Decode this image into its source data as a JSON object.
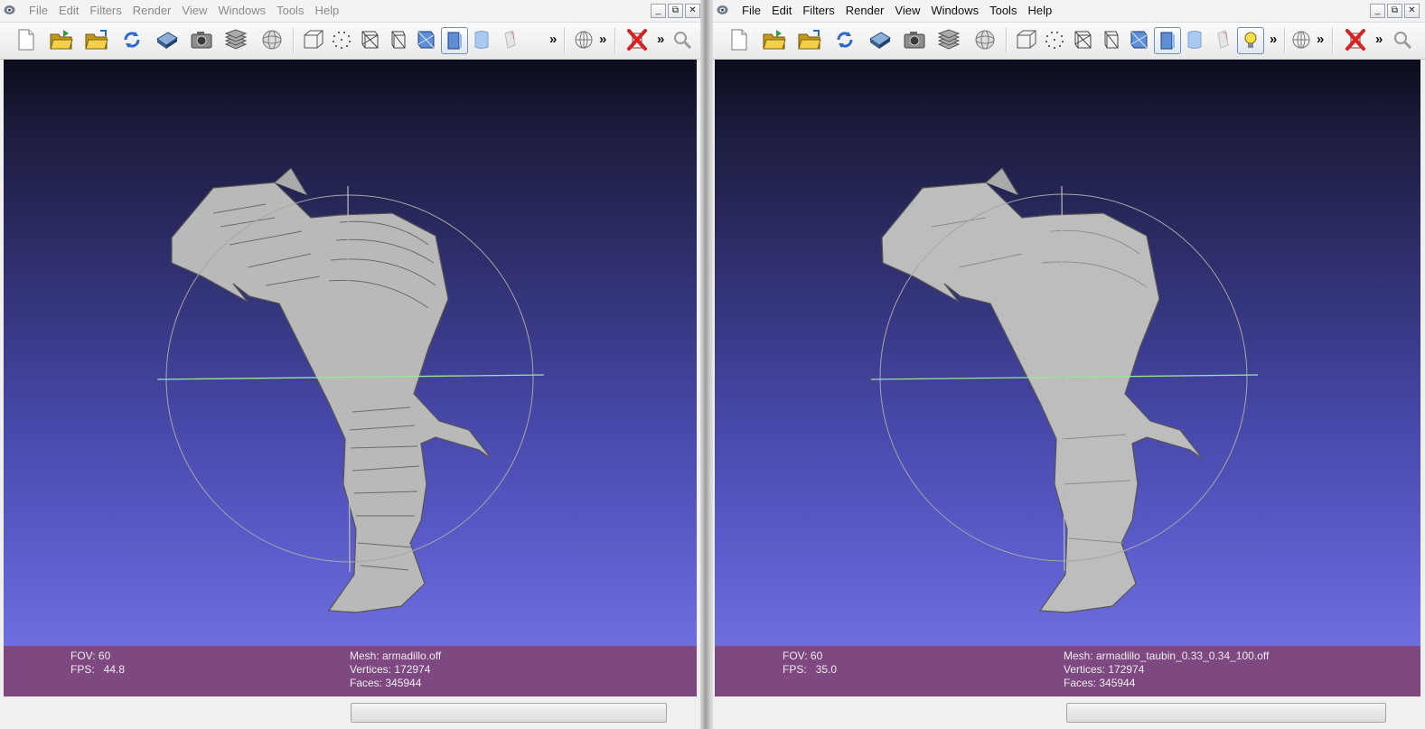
{
  "left": {
    "menus": [
      "File",
      "Edit",
      "Filters",
      "Render",
      "View",
      "Windows",
      "Tools",
      "Help"
    ],
    "window_controls": [
      "_",
      "⧉",
      "✕"
    ],
    "toolbar_overflow": "»",
    "info": {
      "fov": "FOV: 60",
      "fps": "FPS:   44.8",
      "mesh": "Mesh: armadillo.off",
      "vertices": "Vertices: 172974",
      "faces": "Faces: 345944"
    }
  },
  "right": {
    "menus": [
      "File",
      "Edit",
      "Filters",
      "Render",
      "View",
      "Windows",
      "Tools",
      "Help"
    ],
    "window_controls": [
      "_",
      "⧉",
      "✕"
    ],
    "toolbar_overflow": "»",
    "info": {
      "fov": "FOV: 60",
      "fps": "FPS:   35.0",
      "mesh": "Mesh: armadillo_taubin_0.33_0.34_100.off",
      "vertices": "Vertices: 172974",
      "faces": "Faces: 345944"
    }
  },
  "colors": {
    "info_bar": "#7d4980",
    "trackball_axis": "#9be59b",
    "mesh": "#b9b9b9"
  },
  "icons": [
    "new-file-icon",
    "open-folder-icon",
    "import-folder-icon",
    "reload-icon",
    "save-icon",
    "snapshot-icon",
    "layers-icon",
    "globe-icon",
    "bounding-box-icon",
    "points-icon",
    "wireframe-icon",
    "hidden-lines-icon",
    "flat-lines-icon",
    "flat-shading-icon",
    "smooth-shading-icon",
    "texture-icon",
    "light-bulb-icon",
    "trackball-icon",
    "delete-icon",
    "search-icon"
  ]
}
